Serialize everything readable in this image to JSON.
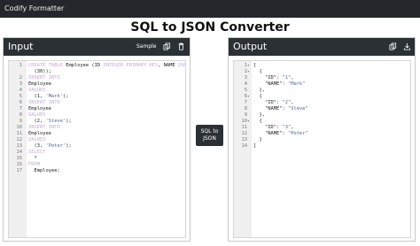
{
  "app": {
    "brand": "Codify Formatter",
    "page_title": "SQL to JSON Converter"
  },
  "input_panel": {
    "title": "Input",
    "sample_label": "Sample"
  },
  "output_panel": {
    "title": "Output"
  },
  "convert_button": {
    "line1": "SQL to",
    "line2": "JSON"
  },
  "colors": {
    "navbar": "#23272b",
    "panel_header": "#2b3035",
    "sql_keyword": "#c7a7d9",
    "string": "#4a6a99"
  },
  "icons": {
    "copy": "copy-icon",
    "delete": "trash-icon",
    "download": "download-icon"
  },
  "input_lines": [
    {
      "n": "1",
      "fold": "",
      "t": "CREATE TABLE Employee (ID INTEGER PRIMARY KEY, NAME CHAR"
    },
    {
      "n": "",
      "fold": "",
      "t": "  (30));"
    },
    {
      "n": "2",
      "fold": "",
      "t": "INSERT INTO"
    },
    {
      "n": "3",
      "fold": "",
      "t": "Employee"
    },
    {
      "n": "4",
      "fold": "",
      "t": "VALUES"
    },
    {
      "n": "5",
      "fold": "",
      "t": "  (1, 'Mark');"
    },
    {
      "n": "6",
      "fold": "",
      "t": "INSERT INTO"
    },
    {
      "n": "7",
      "fold": "",
      "t": "Employee"
    },
    {
      "n": "8",
      "fold": "",
      "t": "VALUES"
    },
    {
      "n": "9",
      "fold": "",
      "t": "  (2, 'Steve');"
    },
    {
      "n": "10",
      "fold": "",
      "t": "INSERT INTO"
    },
    {
      "n": "11",
      "fold": "",
      "t": "Employee"
    },
    {
      "n": "12",
      "fold": "",
      "t": "VALUES"
    },
    {
      "n": "13",
      "fold": "",
      "t": "  (3, 'Peter');"
    },
    {
      "n": "14",
      "fold": "",
      "t": "SELECT"
    },
    {
      "n": "15",
      "fold": "",
      "t": "  *"
    },
    {
      "n": "16",
      "fold": "",
      "t": "FROM"
    },
    {
      "n": "17",
      "fold": "",
      "t": "  Employee;"
    }
  ],
  "output_lines": [
    {
      "n": "1",
      "fold": "▾",
      "t": "["
    },
    {
      "n": "2",
      "fold": "▾",
      "t": "  {"
    },
    {
      "n": "3",
      "fold": "",
      "t": "    \"ID\": \"1\","
    },
    {
      "n": "4",
      "fold": "",
      "t": "    \"NAME\": \"Mark\""
    },
    {
      "n": "5",
      "fold": "",
      "t": "  },"
    },
    {
      "n": "6",
      "fold": "▾",
      "t": "  {"
    },
    {
      "n": "7",
      "fold": "",
      "t": "    \"ID\": \"2\","
    },
    {
      "n": "8",
      "fold": "",
      "t": "    \"NAME\": \"Steve\""
    },
    {
      "n": "9",
      "fold": "",
      "t": "  },"
    },
    {
      "n": "10",
      "fold": "▾",
      "t": "  {"
    },
    {
      "n": "11",
      "fold": "",
      "t": "    \"ID\": \"3\","
    },
    {
      "n": "12",
      "fold": "",
      "t": "    \"NAME\": \"Peter\""
    },
    {
      "n": "13",
      "fold": "",
      "t": "  }"
    },
    {
      "n": "14",
      "fold": "",
      "t": "]"
    }
  ]
}
